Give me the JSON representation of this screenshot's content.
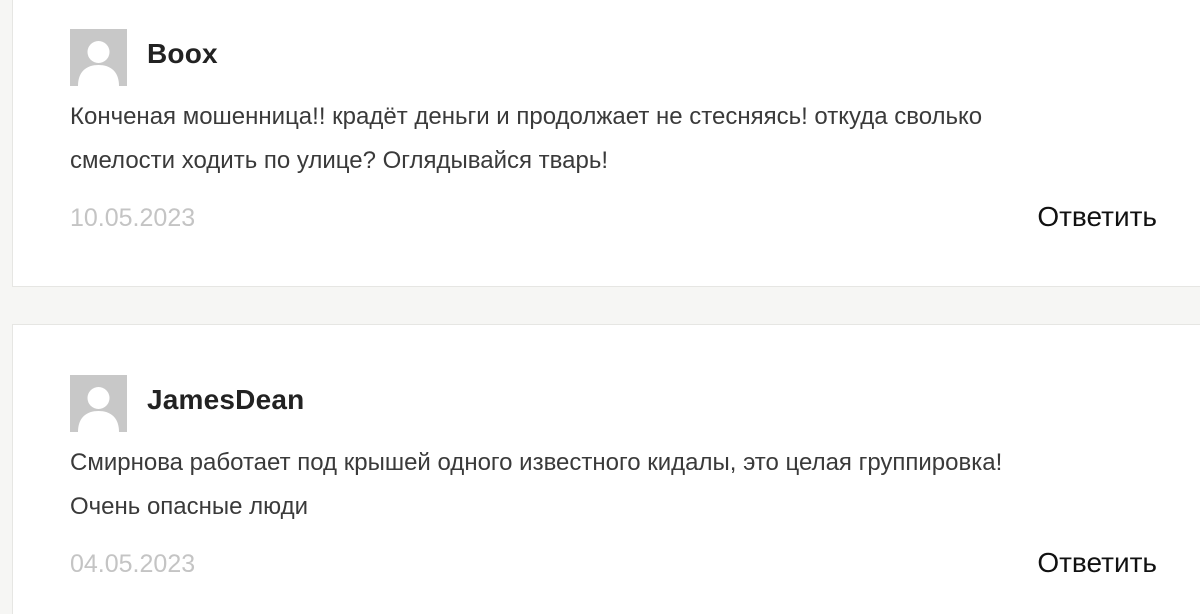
{
  "comments": [
    {
      "author": "Boox",
      "text_lines": [
        "Конченая мошенница!! крадёт деньги и продолжает не стесняясь! откуда сволько",
        "смелости ходить по улице? Оглядывайся тварь!"
      ],
      "date": "10.05.2023",
      "reply_label": "Ответить",
      "avatar_icon": "user-placeholder-icon"
    },
    {
      "author": "JamesDean",
      "text_lines": [
        "Смирнова работает под крышей одного известного кидалы, это целая группировка!",
        "Очень опасные люди"
      ],
      "date": "04.05.2023",
      "reply_label": "Ответить",
      "avatar_icon": "user-placeholder-icon"
    }
  ],
  "colors": {
    "page_background": "#f6f6f4",
    "card_background": "#ffffff",
    "avatar_background": "#c8c8c8",
    "date_text": "#c4c4c4",
    "body_text": "#3a3a3a"
  }
}
